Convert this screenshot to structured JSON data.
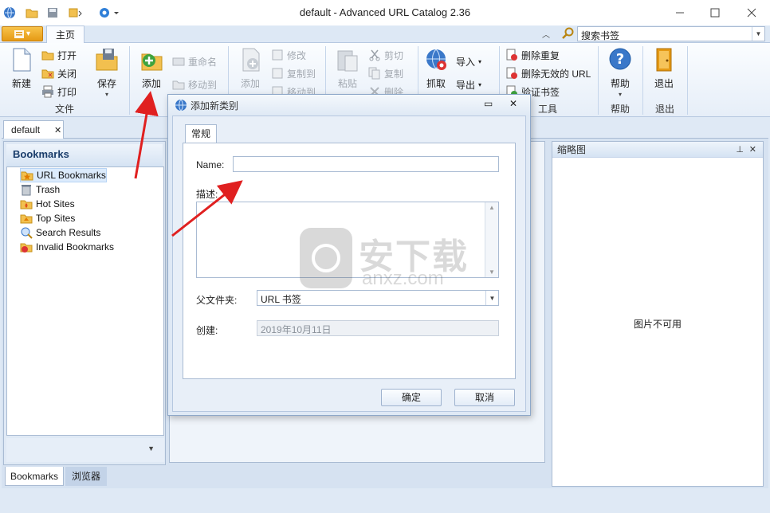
{
  "window": {
    "title": "default - Advanced URL Catalog 2.36"
  },
  "ribbon": {
    "tab_home": "主页",
    "search_placeholder": "搜索书签",
    "groups": {
      "file": {
        "label": "文件",
        "new": "新建",
        "open": "打开",
        "close": "关闭",
        "print": "打印",
        "save": "保存"
      },
      "category": {
        "add": "添加",
        "rename": "重命名",
        "move_to": "移动到"
      },
      "bookmark": {
        "add": "添加",
        "modify": "修改",
        "copy_to": "复制到",
        "move_to": "移动到"
      },
      "clipboard": {
        "paste": "粘贴",
        "cut": "剪切",
        "copy": "复制",
        "delete": "删除"
      },
      "import": {
        "fetch": "抓取",
        "import": "导入",
        "export": "导出"
      },
      "tools": {
        "label": "工具",
        "remove_duplicates": "删除重复",
        "remove_invalid": "删除无效的 URL",
        "verify": "验证书签"
      },
      "help": {
        "label": "帮助",
        "help": "帮助"
      },
      "exit": {
        "label": "退出",
        "exit": "退出"
      }
    }
  },
  "doc_tab": {
    "label": "default",
    "close": "✕"
  },
  "left_panel": {
    "title": "Bookmarks",
    "items": [
      {
        "label": "URL Bookmarks",
        "icon": "folder-star-icon",
        "selected": true
      },
      {
        "label": "Trash",
        "icon": "trash-icon",
        "selected": false
      },
      {
        "label": "Hot Sites",
        "icon": "hot-sites-icon",
        "selected": false
      },
      {
        "label": "Top Sites",
        "icon": "top-sites-icon",
        "selected": false
      },
      {
        "label": "Search Results",
        "icon": "search-results-icon",
        "selected": false
      },
      {
        "label": "Invalid Bookmarks",
        "icon": "invalid-bookmarks-icon",
        "selected": false
      }
    ],
    "bottom_tabs": [
      "Bookmarks",
      "浏览器"
    ]
  },
  "right_panel": {
    "title": "缩略图",
    "empty_text": "图片不可用"
  },
  "dialog": {
    "title": "添加新类别",
    "tab": "常规",
    "name_label": "Name:",
    "name_value": "",
    "desc_label": "描述:",
    "desc_value": "",
    "parent_label": "父文件夹:",
    "parent_value": "URL 书签",
    "created_label": "创建:",
    "created_value": "2019年10月11日",
    "ok": "确定",
    "cancel": "取消"
  },
  "watermark": {
    "text_cn": "安下载",
    "text_en": "anxz.com"
  },
  "colors": {
    "accent": "#e59a15",
    "arrow": "#e02020",
    "selection": "#dcebfc"
  }
}
